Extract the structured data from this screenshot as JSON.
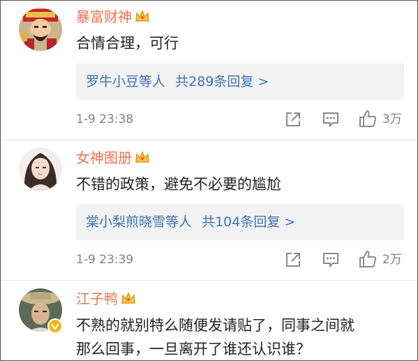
{
  "comments": [
    {
      "username": "暴富财神",
      "text": "合情合理，可行",
      "reply_users": "罗牛小豆等人",
      "reply_count": "共289条回复 >",
      "time": "1-9 23:38",
      "likes": "3万"
    },
    {
      "username": "女神图册",
      "text": "不错的政策，避免不必要的尴尬",
      "reply_users": "棠小梨煎晓雪等人",
      "reply_count": "共104条回复 >",
      "time": "1-9 23:39",
      "likes": "2万"
    },
    {
      "username": "江子鸭",
      "text_line1": "不熟的就别特么随便发请贴了，同事之间就",
      "text_line2": "那么回事，一旦离开了谁还认识谁？"
    }
  ],
  "icons": [
    "share-icon",
    "comment-icon",
    "like-icon",
    "crown-badge-icon",
    "verified-badge-icon"
  ],
  "colors": {
    "username": "#eb7350",
    "link": "#3c73b4",
    "text": "#222222",
    "meta": "#808080",
    "reply_bg": "#f2f2f2"
  }
}
